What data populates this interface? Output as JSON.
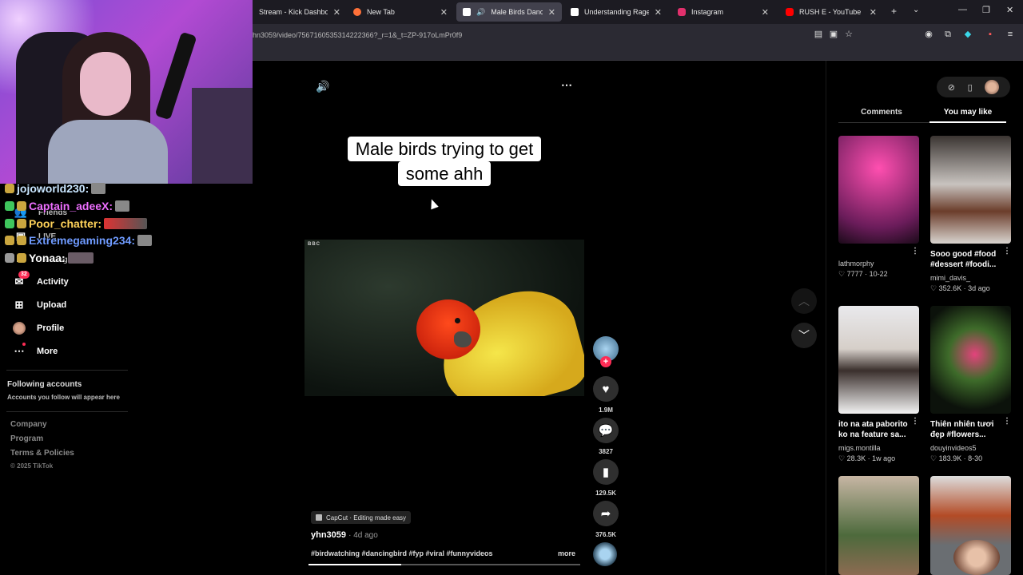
{
  "browser": {
    "tabs": [
      {
        "title": "Stream - Kick Dashboard",
        "favicon_color": "#53fc18",
        "active": false
      },
      {
        "title": "New Tab",
        "favicon_color": "#ff7139",
        "active": false
      },
      {
        "title": "Male Birds Dancing to ...",
        "favicon_color": "#ffffff",
        "active": true
      },
      {
        "title": "Understanding Rage Baiting...",
        "favicon_color": "#ffffff",
        "active": false
      },
      {
        "title": "Instagram",
        "favicon_color": "#e1306c",
        "active": false
      },
      {
        "title": "RUSH E - YouTube",
        "favicon_color": "#ff0000",
        "active": false
      }
    ],
    "url": "hn3059/video/7567160535314222366?_r=1&_t=ZP-917oLmPr0f9"
  },
  "chat": [
    {
      "username": "jojoworld230:",
      "color": "#c9e6ff"
    },
    {
      "username": "Captain_adeeX:",
      "color": "#ee6fff"
    },
    {
      "username": "Poor_chatter:",
      "color": "#ffd35a"
    },
    {
      "username": "Extremegaming234:",
      "color": "#6f9bff"
    },
    {
      "username": "Yonaa:",
      "color": "#ffffff"
    }
  ],
  "sidebar": {
    "partial_items": [
      "Friends",
      "LIVE",
      "Messages"
    ],
    "items": [
      {
        "label": "Activity",
        "badge": "32"
      },
      {
        "label": "Upload"
      },
      {
        "label": "Profile"
      },
      {
        "label": "More"
      }
    ],
    "following_title": "Following accounts",
    "following_sub": "Accounts you follow will appear here",
    "footer": [
      "Company",
      "Program",
      "Terms & Policies"
    ],
    "copyright": "© 2025 TikTok"
  },
  "video": {
    "caption_line1": "Male birds trying to get",
    "caption_line2": "some ahh",
    "watermark": "BBC",
    "likes": "1.9M",
    "comments": "3827",
    "saves": "129.5K",
    "shares": "376.5K",
    "capcut": "CapCut · Editing made easy",
    "author": "yhn3059",
    "age": "· 4d ago",
    "hashtags": "#birdwatching #dancingbird #fyp #viral #funnyvideos",
    "more": "more",
    "progress": 0.34
  },
  "right_panel": {
    "tab_comments": "Comments",
    "tab_you_may_like": "You may like",
    "cards": [
      {
        "title": "",
        "author": "lathmorphy",
        "meta": "♡ 7777 · 10-22"
      },
      {
        "title": "Sooo good #food #dessert #foodi...",
        "author": "mimi_davis_",
        "meta": "♡ 352.6K · 3d ago"
      },
      {
        "title": "ito na ata paborito ko na feature sa...",
        "author": "migs.montilla",
        "meta": "♡ 28.3K · 1w ago"
      },
      {
        "title": "Thiên nhiên tươi đẹp #flowers...",
        "author": "douyinvideos5",
        "meta": "♡ 183.9K · 8-30"
      },
      {
        "title": "",
        "author": "",
        "meta": ""
      },
      {
        "title": "",
        "author": "",
        "meta": ""
      }
    ]
  }
}
